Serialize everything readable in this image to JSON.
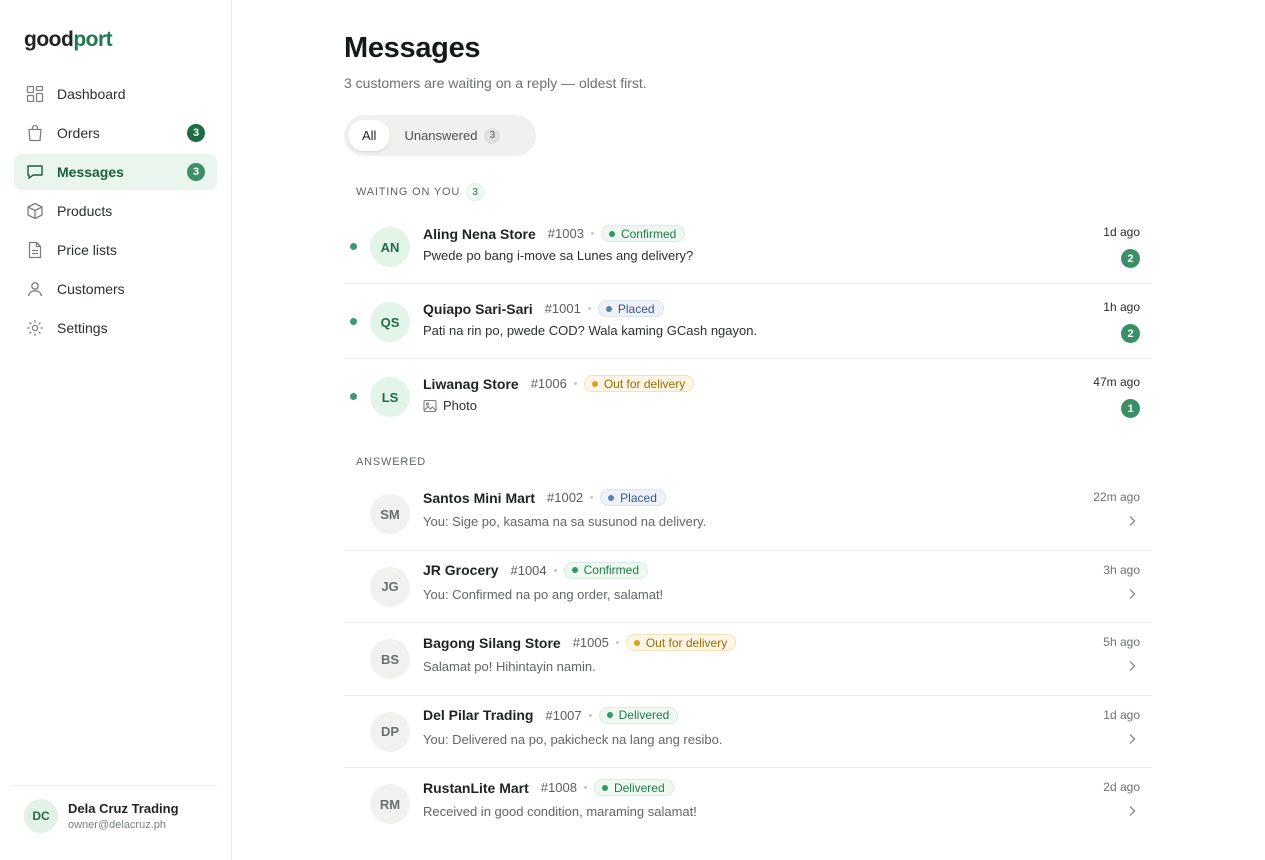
{
  "brand": {
    "part1": "good",
    "part2": "port"
  },
  "sidebar": {
    "items": [
      {
        "label": "Dashboard",
        "icon": "dashboard-icon"
      },
      {
        "label": "Orders",
        "icon": "bag-icon",
        "badge": "3"
      },
      {
        "label": "Messages",
        "icon": "chat-icon",
        "badge": "3",
        "active": true
      },
      {
        "label": "Products",
        "icon": "box-icon"
      },
      {
        "label": "Price lists",
        "icon": "document-icon"
      },
      {
        "label": "Customers",
        "icon": "user-icon"
      },
      {
        "label": "Settings",
        "icon": "gear-icon"
      }
    ]
  },
  "account": {
    "initials": "DC",
    "name": "Dela Cruz Trading",
    "email": "owner@delacruz.ph"
  },
  "page": {
    "title": "Messages",
    "subtitle": "3 customers are waiting on a reply — oldest first."
  },
  "tabs": {
    "all": "All",
    "unanswered": "Unanswered",
    "unanswered_count": "3"
  },
  "sections": {
    "waiting_label": "WAITING ON YOU",
    "waiting_count": "3",
    "answered_label": "ANSWERED"
  },
  "colors": {
    "brand_green": "#1f7a4d",
    "active_nav_bg": "#eaf5ee",
    "badge_green": "#1e6b45",
    "status_confirmed": "#2f9863",
    "status_placed": "#5a7fb0",
    "status_out_for_delivery": "#d9a21c"
  },
  "waiting": [
    {
      "initials": "AN",
      "name": "Aling Nena Store",
      "order": "#1003",
      "status": "Confirmed",
      "status_kind": "confirmed",
      "message": "Pwede po bang i-move sa Lunes ang delivery?",
      "time": "1d ago",
      "unread": "2"
    },
    {
      "initials": "QS",
      "name": "Quiapo Sari-Sari",
      "order": "#1001",
      "status": "Placed",
      "status_kind": "placed",
      "message": "Pati na rin po, pwede COD? Wala kaming GCash ngayon.",
      "time": "1h ago",
      "unread": "2"
    },
    {
      "initials": "LS",
      "name": "Liwanag Store",
      "order": "#1006",
      "status": "Out for delivery",
      "status_kind": "delivery",
      "message": "Photo",
      "attachment_icon": "photo-icon",
      "time": "47m ago",
      "unread": "1"
    }
  ],
  "answered": [
    {
      "initials": "SM",
      "name": "Santos Mini Mart",
      "order": "#1002",
      "status": "Placed",
      "status_kind": "placed",
      "message": "You: Sige po, kasama na sa susunod na delivery.",
      "time": "22m ago"
    },
    {
      "initials": "JG",
      "name": "JR Grocery",
      "order": "#1004",
      "status": "Confirmed",
      "status_kind": "confirmed",
      "message": "You: Confirmed na po ang order, salamat!",
      "time": "3h ago"
    },
    {
      "initials": "BS",
      "name": "Bagong Silang Store",
      "order": "#1005",
      "status": "Out for delivery",
      "status_kind": "delivery",
      "message": "Salamat po! Hihintayin namin.",
      "time": "5h ago"
    },
    {
      "initials": "DP",
      "name": "Del Pilar Trading",
      "order": "#1007",
      "status": "Delivered",
      "status_kind": "delivered",
      "message": "You: Delivered na po, pakicheck na lang ang resibo.",
      "time": "1d ago"
    },
    {
      "initials": "RM",
      "name": "RustanLite Mart",
      "order": "#1008",
      "status": "Delivered",
      "status_kind": "delivered",
      "message": "Received in good condition, maraming salamat!",
      "time": "2d ago"
    }
  ]
}
